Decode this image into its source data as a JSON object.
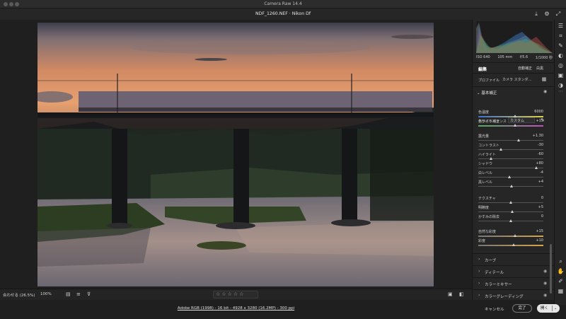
{
  "window": {
    "title": "Camera Raw 14.4"
  },
  "file": {
    "title": "NDF_1260.NEF  ·  Nikon Df"
  },
  "exif": {
    "iso": "ISO 640",
    "focal": "105 mm",
    "aperture": "f/5.6",
    "shutter": "1/1000 秒"
  },
  "panel": {
    "edit_title": "編集",
    "auto_label": "自動補正",
    "bw_label": "白黒",
    "profile_label": "プロファイル",
    "profile_value": "カメラ スタンダ…",
    "basic_title": "基本補正",
    "wb_label": "ホワイトバランス",
    "wb_value": "カスタム",
    "sliders": [
      {
        "label": "色温度",
        "value": "6000",
        "pos": 0.57
      },
      {
        "label": "色かぶり補正",
        "value": "+15",
        "pos": 0.57
      },
      {
        "label": "露光量",
        "value": "+1.30",
        "pos": 0.63
      },
      {
        "label": "コントラスト",
        "value": "-30",
        "pos": 0.35
      },
      {
        "label": "ハイライト",
        "value": "-60",
        "pos": 0.2
      },
      {
        "label": "シャドウ",
        "value": "+80",
        "pos": 0.9
      },
      {
        "label": "白レベル",
        "value": "-4",
        "pos": 0.48
      },
      {
        "label": "黒レベル",
        "value": "+4",
        "pos": 0.52
      },
      {
        "label": "テクスチャ",
        "value": "0",
        "pos": 0.5
      },
      {
        "label": "明瞭度",
        "value": "+5",
        "pos": 0.53
      },
      {
        "label": "かすみの除去",
        "value": "0",
        "pos": 0.5
      },
      {
        "label": "自然な彩度",
        "value": "+15",
        "pos": 0.57
      },
      {
        "label": "彩度",
        "value": "+10",
        "pos": 0.55
      }
    ],
    "sections": [
      "カーブ",
      "ディテール",
      "カラーミキサー",
      "カラーグレーディング"
    ]
  },
  "bottom": {
    "zoom_fit": "合わせる (26.5%)",
    "zoom_pct": "100%",
    "stars": "☆☆☆☆☆"
  },
  "footer": {
    "info": "Adobe RGB (1998) - 16 bit - 4928 x 3280 (16.2MP) - 300 ppi",
    "cancel": "キャンセル",
    "done": "完了",
    "open": "開く"
  },
  "colors": {
    "accent": "#4a90e2",
    "panel": "#262626",
    "background": "#1f1f1f"
  }
}
